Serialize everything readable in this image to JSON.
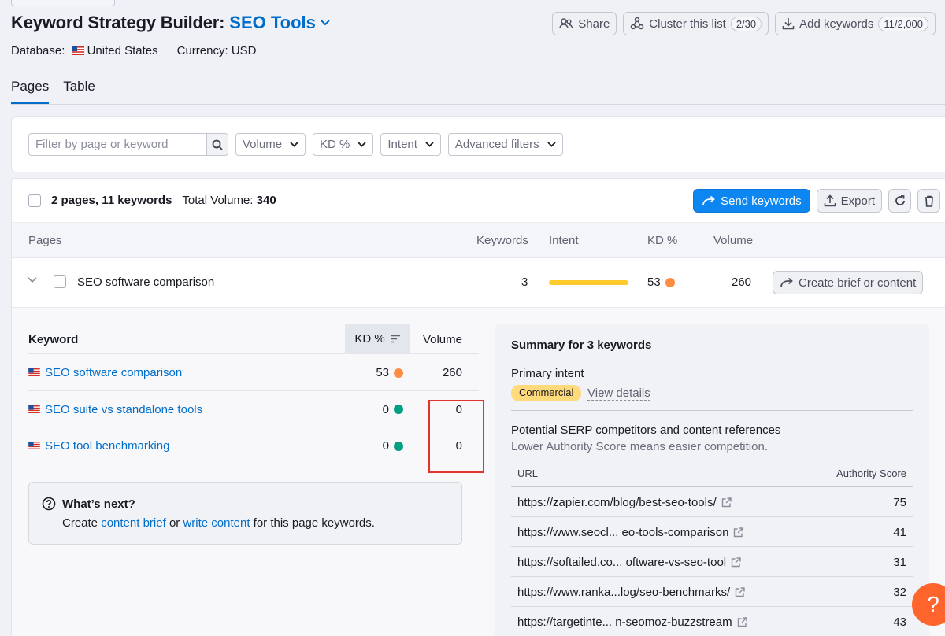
{
  "header": {
    "title": "Keyword Strategy Builder:",
    "project": "SEO Tools",
    "database_label": "Database:",
    "database_value": "United States",
    "currency_label": "Currency:",
    "currency_value": "USD",
    "share_label": "Share",
    "cluster_label": "Cluster this list",
    "cluster_count": "2/30",
    "add_label": "Add keywords",
    "add_count": "11/2,000"
  },
  "tabs": [
    {
      "label": "Pages",
      "active": true
    },
    {
      "label": "Table",
      "active": false
    }
  ],
  "filters": {
    "search_placeholder": "Filter by page or keyword",
    "volume": "Volume",
    "kd": "KD %",
    "intent": "Intent",
    "advanced": "Advanced filters"
  },
  "toolbar": {
    "summary": "2 pages, 11 keywords",
    "total_volume_label": "Total Volume:",
    "total_volume_value": "340",
    "send_label": "Send keywords",
    "export_label": "Export"
  },
  "columns": {
    "pages": "Pages",
    "keywords": "Keywords",
    "intent": "Intent",
    "kd": "KD %",
    "volume": "Volume"
  },
  "page_row": {
    "name": "SEO software comparison",
    "keywords": "3",
    "kd": "53",
    "kd_color": "#ff8c43",
    "intent_color": "#ffca2b",
    "volume": "260",
    "brief_label": "Create brief or content"
  },
  "keyword_table": {
    "headers": {
      "keyword": "Keyword",
      "kd": "KD %",
      "volume": "Volume"
    },
    "rows": [
      {
        "keyword": "SEO software comparison",
        "kd": "53",
        "kd_color": "#ff8c43",
        "volume": "260"
      },
      {
        "keyword": "SEO suite vs standalone tools",
        "kd": "0",
        "kd_color": "#009f81",
        "volume": "0"
      },
      {
        "keyword": "SEO tool benchmarking",
        "kd": "0",
        "kd_color": "#009f81",
        "volume": "0"
      }
    ]
  },
  "whats_next": {
    "title": "What’s next?",
    "text_1": "Create",
    "link_1": "content brief",
    "text_2": "or",
    "link_2": "write content",
    "text_3": "for this page keywords."
  },
  "summary": {
    "title": "Summary for 3 keywords",
    "primary_intent_label": "Primary intent",
    "intent_badge": "Commercial",
    "view_details": "View details",
    "competitors_title": "Potential SERP competitors and content references",
    "competitors_note": "Lower Authority Score means easier competition.",
    "url_header": "URL",
    "score_header": "Authority Score",
    "urls": [
      {
        "url": "https://zapier.com/blog/best-seo-tools/",
        "score": "75"
      },
      {
        "url": "https://www.seocl... eo-tools-comparison",
        "score": "41"
      },
      {
        "url": "https://softailed.co... oftware-vs-seo-tool",
        "score": "31"
      },
      {
        "url": "https://www.ranka...log/seo-benchmarks/",
        "score": "32"
      },
      {
        "url": "https://targetinte... n-seomoz-buzzstream",
        "score": "43"
      }
    ]
  },
  "help": {
    "label": "?"
  },
  "colors": {
    "accent": "#006dca",
    "primary_button": "#0c86f0",
    "help": "#ff642d",
    "highlight": "#e2342b"
  }
}
